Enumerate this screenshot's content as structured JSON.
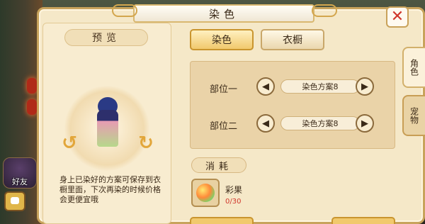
{
  "window": {
    "title": "染色"
  },
  "preview": {
    "header": "预览",
    "note": "身上已染好的方案可保存到衣橱里面，下次再染的时候价格会更便宜哦"
  },
  "tabs": {
    "dye": "染色",
    "wardrobe": "衣橱"
  },
  "side_tabs": [
    {
      "label": "角色",
      "active": true
    },
    {
      "label": "宠物",
      "active": false
    }
  ],
  "parts": [
    {
      "label": "部位一",
      "scheme": "染色方案8"
    },
    {
      "label": "部位二",
      "scheme": "染色方案8"
    }
  ],
  "consume": {
    "header": "消耗",
    "item_name": "彩果",
    "item_count": "0/30"
  },
  "hud": {
    "friend_label": "好友"
  },
  "icons": {
    "close": "close-icon",
    "rotate_left": "rotate-left-icon",
    "rotate_right": "rotate-right-icon",
    "prev": "triangle-left-icon",
    "next": "triangle-right-icon",
    "item": "colorful-fruit-icon",
    "chat": "chat-icon"
  },
  "colors": {
    "accent": "#f1c96d",
    "panel": "#f5e8c8",
    "border": "#c8a35c",
    "close": "#d0362b"
  }
}
